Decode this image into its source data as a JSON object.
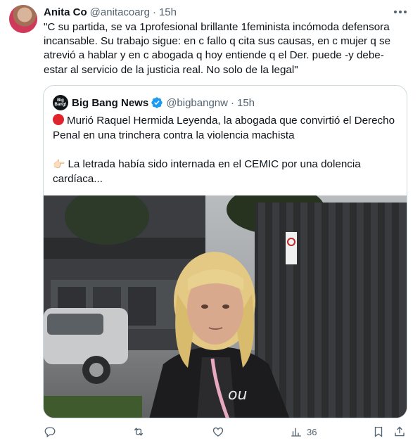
{
  "tweet": {
    "author_name": "Anita Co",
    "author_handle": "@anitacoarg",
    "separator": "·",
    "time": "15h",
    "text": "\"C su partida, se va 1profesional brillante 1feminista incómoda defensora incansable. Su trabajo sigue: en c fallo q cita sus causas, en c mujer q se atrevió a hablar y en c abogada q hoy entiende q el Der. puede -y debe- estar al servicio de la justicia real. No solo de la legal\""
  },
  "quoted": {
    "logo_text": "Big Bang!",
    "author_name": "Big Bang News",
    "author_handle": "@bigbangnw",
    "separator": "·",
    "time": "15h",
    "line1": "Murió Raquel Hermida Leyenda, la abogada que convirtió el Derecho Penal en una trinchera contra la violencia machista",
    "line2": "La letrada había sido internada en el CEMIC por una dolencia cardíaca...",
    "photo_sign_text": "",
    "shirt_text": "ou"
  },
  "actions": {
    "reply_count": "",
    "retweet_count": "",
    "like_count": "",
    "views_count": "36"
  },
  "colors": {
    "text": "#0f1419",
    "secondary": "#536471",
    "border": "#cfd9de",
    "verified": "#1d9bf0",
    "red_circle": "#e0242e"
  },
  "icons": [
    "more-icon",
    "verified-icon",
    "red-circle-icon",
    "pointing-hand-icon",
    "reply-icon",
    "retweet-icon",
    "like-icon",
    "views-icon",
    "bookmark-icon",
    "share-icon"
  ]
}
